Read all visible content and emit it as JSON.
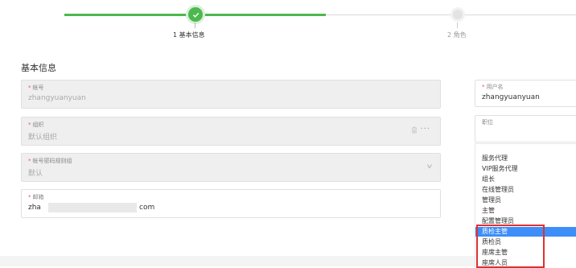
{
  "stepper": {
    "steps": [
      {
        "label": "1 基本信息",
        "status": "done"
      },
      {
        "label": "2 角色",
        "status": "pending"
      }
    ],
    "active_color": "#4db84d"
  },
  "section_title": "基本信息",
  "fields": {
    "account": {
      "label": "帐号",
      "required": true,
      "value": "zhangyuanyuan",
      "disabled": true
    },
    "org": {
      "label": "组织",
      "required": true,
      "value": "默认组织",
      "disabled": true,
      "icons": [
        "trash-icon",
        "more-icon"
      ]
    },
    "password_rule": {
      "label": "帐号密码规则组",
      "required": true,
      "value": "默认",
      "disabled": true,
      "icons": [
        "chevron-down-icon"
      ]
    },
    "email": {
      "label": "邮箱",
      "required": true,
      "value_prefix": "zha",
      "value_suffix": "com",
      "disabled": false
    }
  },
  "right_fields": {
    "username": {
      "label": "用户名",
      "required": true,
      "value": "zhangyuanyuan"
    },
    "position": {
      "label": "职位",
      "required": false,
      "value": ""
    }
  },
  "position_dropdown": {
    "options": [
      "服务代理",
      "VIP服务代理",
      "组长",
      "在线管理员",
      "管理员",
      "主管",
      "配置管理员",
      "质检主管",
      "质检员",
      "座席主管",
      "座席人员"
    ],
    "selected": "质检主管",
    "selected_color": "#3d8ef8",
    "highlight_color": "#e03030"
  },
  "required_mark": "*"
}
